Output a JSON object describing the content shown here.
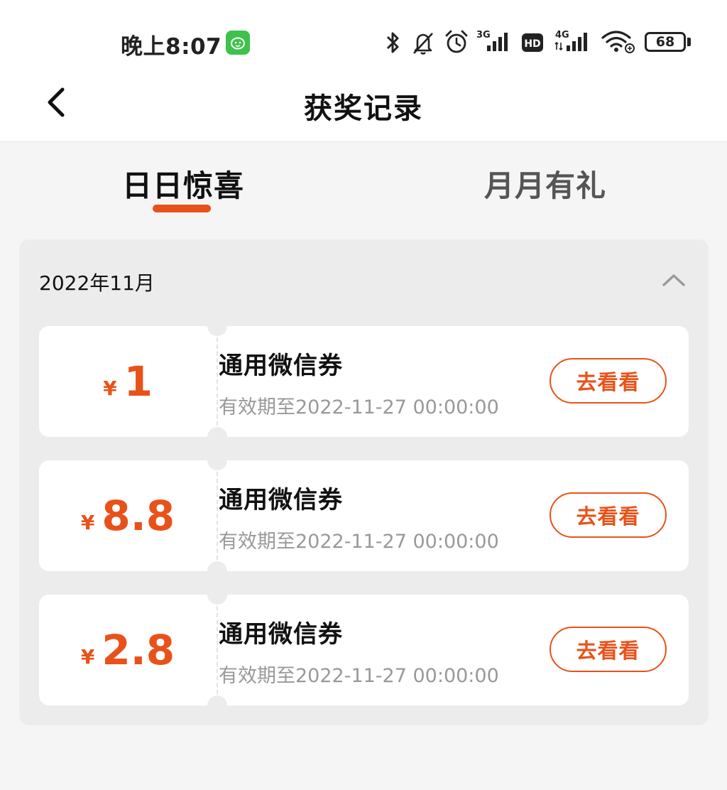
{
  "status_bar": {
    "time": "晚上8:07",
    "battery": "68",
    "signal_3g_label": "3G",
    "signal_4g_label": "4G",
    "hd_label": "HD",
    "icons": [
      "bluetooth-icon",
      "bell-off-icon",
      "alarm-icon",
      "signal-3g-icon",
      "hd-icon",
      "signal-4g-icon",
      "wifi-icon",
      "battery-icon"
    ]
  },
  "nav": {
    "title": "获奖记录",
    "back_icon": "chevron-left-icon"
  },
  "tabs": [
    {
      "label": "日日惊喜",
      "active": true
    },
    {
      "label": "月月有礼",
      "active": false
    }
  ],
  "month_group": {
    "title": "2022年11月",
    "collapse_icon": "chevron-up-icon",
    "coupons": [
      {
        "currency": "¥",
        "amount": "1",
        "name": "通用微信券",
        "expiry": "有效期至2022-11-27 00:00:00",
        "button": "去看看"
      },
      {
        "currency": "¥",
        "amount": "8.8",
        "name": "通用微信券",
        "expiry": "有效期至2022-11-27 00:00:00",
        "button": "去看看"
      },
      {
        "currency": "¥",
        "amount": "2.8",
        "name": "通用微信券",
        "expiry": "有效期至2022-11-27 00:00:00",
        "button": "去看看"
      }
    ]
  },
  "colors": {
    "accent": "#e8521a",
    "page_bg": "#f5f5f5",
    "panel_bg": "#ececec",
    "muted_text": "#999999"
  }
}
